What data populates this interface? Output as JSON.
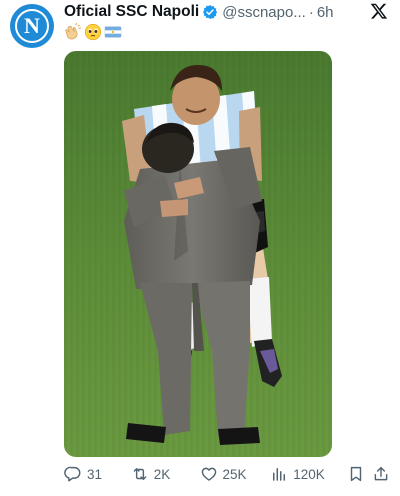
{
  "tweet": {
    "display_name": "Oficial SSC Napoli",
    "handle": "@sscnapo...",
    "separator": "·",
    "time": "6h",
    "avatar_letter": "N",
    "emojis": [
      "clapping-hands",
      "pleading-face",
      "argentina-flag"
    ],
    "brand_color": "#1f8ad6",
    "verified_color": "#1d9bf0",
    "media_alt": "Diego Maradona in a grey suit hugging Lionel Messi in an Argentina kit on a football pitch"
  },
  "actions": {
    "replies": "31",
    "retweets": "2K",
    "likes": "25K",
    "views": "120K"
  }
}
